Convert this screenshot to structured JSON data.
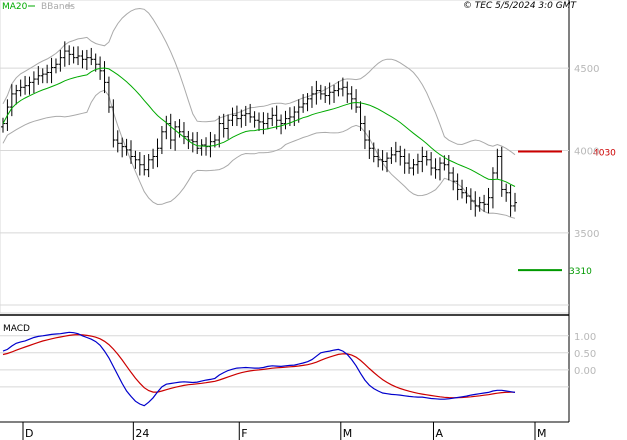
{
  "header": {
    "legend_ma": "MA20",
    "legend_bb": "BBands",
    "copyright": "© TEC 5/5/2024 3:0 GMT"
  },
  "chart_data": [
    {
      "type": "line",
      "name": "price-chart",
      "y_ticks": [
        {
          "value": 4500,
          "label": "4500"
        },
        {
          "value": 4000,
          "label": "4000"
        },
        {
          "value": 3500,
          "label": "3500"
        }
      ],
      "ylim": [
        3050,
        4950
      ],
      "x_labels": [
        {
          "index": 0,
          "label": "D"
        },
        {
          "index": 25,
          "label": "24"
        },
        {
          "index": 49,
          "label": "F"
        },
        {
          "index": 72,
          "label": "M"
        },
        {
          "index": 93,
          "label": "A"
        },
        {
          "index": 116,
          "label": "M"
        }
      ],
      "levels": [
        {
          "label": "4030",
          "value": 4030,
          "color": "#cc0000"
        },
        {
          "label": "3310",
          "value": 3310,
          "color": "#009900"
        }
      ],
      "series": [
        {
          "name": "MA20",
          "color": "#00aa00"
        },
        {
          "name": "BBands",
          "color": "#aaaaaa"
        }
      ],
      "close": [
        4200,
        4300,
        4380,
        4400,
        4420,
        4430,
        4450,
        4470,
        4490,
        4500,
        4510,
        4540,
        4560,
        4600,
        4640,
        4620,
        4600,
        4610,
        4590,
        4600,
        4590,
        4560,
        4520,
        4450,
        4300,
        4100,
        4080,
        4060,
        4040,
        4000,
        3980,
        3950,
        3920,
        3980,
        4000,
        4050,
        4150,
        4200,
        4100,
        4180,
        4150,
        4120,
        4100,
        4090,
        4050,
        4070,
        4060,
        4090,
        4100,
        4200,
        4170,
        4220,
        4250,
        4230,
        4250,
        4260,
        4240,
        4220,
        4210,
        4200,
        4230,
        4250,
        4220,
        4200,
        4230,
        4240,
        4270,
        4300,
        4320,
        4350,
        4380,
        4400,
        4380,
        4370,
        4390,
        4400,
        4410,
        4420,
        4380,
        4350,
        4300,
        4200,
        4100,
        4050,
        4000,
        3980,
        3970,
        3990,
        4010,
        4030,
        4000,
        3960,
        3930,
        3950,
        3970,
        4000,
        3980,
        3930,
        3920,
        3960,
        3950,
        3900,
        3850,
        3800,
        3780,
        3760,
        3730,
        3700,
        3720,
        3710,
        3750,
        3900,
        4000,
        3800,
        3780,
        3700,
        3720
      ],
      "macd": [
        0.55,
        0.6,
        0.7,
        0.78,
        0.82,
        0.85,
        0.9,
        0.95,
        0.98,
        1.0,
        1.02,
        1.04,
        1.05,
        1.06,
        1.08,
        1.1,
        1.09,
        1.06,
        1.0,
        0.95,
        0.9,
        0.83,
        0.72,
        0.55,
        0.35,
        0.1,
        -0.15,
        -0.4,
        -0.62,
        -0.78,
        -0.92,
        -1.0,
        -1.05,
        -0.95,
        -0.82,
        -0.65,
        -0.5,
        -0.42,
        -0.4,
        -0.38,
        -0.36,
        -0.35,
        -0.36,
        -0.37,
        -0.36,
        -0.33,
        -0.3,
        -0.28,
        -0.25,
        -0.15,
        -0.08,
        -0.02,
        0.02,
        0.05,
        0.06,
        0.07,
        0.06,
        0.05,
        0.05,
        0.07,
        0.1,
        0.12,
        0.11,
        0.1,
        0.12,
        0.13,
        0.14,
        0.17,
        0.2,
        0.24,
        0.3,
        0.4,
        0.5,
        0.53,
        0.55,
        0.58,
        0.6,
        0.55,
        0.45,
        0.3,
        0.12,
        -0.1,
        -0.3,
        -0.45,
        -0.55,
        -0.62,
        -0.68,
        -0.7,
        -0.72,
        -0.73,
        -0.74,
        -0.76,
        -0.78,
        -0.79,
        -0.8,
        -0.8,
        -0.82,
        -0.84,
        -0.85,
        -0.86,
        -0.86,
        -0.85,
        -0.83,
        -0.81,
        -0.79,
        -0.77,
        -0.74,
        -0.72,
        -0.7,
        -0.68,
        -0.66,
        -0.62,
        -0.6,
        -0.6,
        -0.62,
        -0.64,
        -0.66
      ]
    },
    {
      "type": "line",
      "name": "macd-panel",
      "title": "MACD",
      "y_ticks": [
        {
          "value": 1.0,
          "label": "1.00"
        },
        {
          "value": 0.5,
          "label": "0.50"
        },
        {
          "value": 0.0,
          "label": "0.00"
        }
      ],
      "ylim": [
        -1.5,
        1.55
      ],
      "series": [
        {
          "name": "MACD",
          "color": "#0000cc"
        },
        {
          "name": "Signal",
          "color": "#cc0000"
        }
      ]
    }
  ]
}
